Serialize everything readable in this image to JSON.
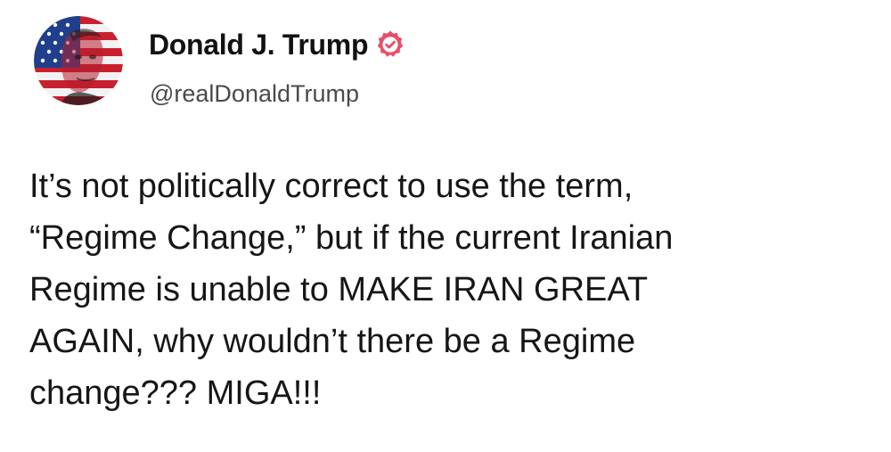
{
  "author": {
    "display_name": "Donald J. Trump",
    "handle": "@realDonaldTrump",
    "avatar_icon": "flag-portrait-avatar",
    "verified_icon": "verified-badge-icon",
    "verified_color": "#e84f6a"
  },
  "post": {
    "text": "It’s not politically correct to use the term,\n“Regime Change,” but if the current Iranian\nRegime is unable to MAKE IRAN GREAT\nAGAIN, why wouldn’t there be a Regime\nchange??? MIGA!!!"
  }
}
